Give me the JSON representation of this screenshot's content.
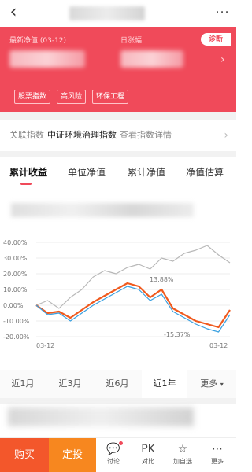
{
  "header": {
    "back_icon": "chevron-left-icon",
    "more_icon": "more-dots-icon"
  },
  "summary": {
    "nav_label": "最新净值 (03-12)",
    "rise_label": "日涨幅",
    "diagnose_label": "诊断",
    "tags": [
      "股票指数",
      "高风险",
      "环保工程"
    ]
  },
  "index": {
    "label": "关联指数",
    "name": "中证环境治理指数",
    "detail": "查看指数详情"
  },
  "tabs": [
    "累计收益",
    "单位净值",
    "累计净值",
    "净值估算"
  ],
  "chart_data": {
    "type": "line",
    "y_ticks": [
      "40.00%",
      "30.00%",
      "20.00%",
      "10.00%",
      "0.00%",
      "-10.00%",
      "-20.00%"
    ],
    "ylim": [
      -20,
      40
    ],
    "x_ticks": [
      "03-12",
      "03-12"
    ],
    "annotations": [
      "13.88%",
      "-15.37%"
    ],
    "series": [
      {
        "color": "#b8b8b8",
        "values": [
          0,
          3,
          -2,
          5,
          10,
          18,
          22,
          20,
          24,
          26,
          23,
          30,
          28,
          33,
          35,
          38,
          32,
          27
        ]
      },
      {
        "color": "#f05a1e",
        "values": [
          0,
          -5,
          -4,
          -8,
          -3,
          2,
          6,
          10,
          14,
          12,
          5,
          10,
          -2,
          -6,
          -10,
          -12,
          -14,
          -3
        ]
      },
      {
        "color": "#3aa0e0",
        "values": [
          0,
          -6,
          -5,
          -10,
          -5,
          0,
          4,
          8,
          12,
          10,
          3,
          7,
          -4,
          -8,
          -12,
          -15,
          -17,
          -6
        ]
      }
    ]
  },
  "ranges": [
    "近1月",
    "近3月",
    "近6月",
    "近1年",
    "更多"
  ],
  "bottom": {
    "buy_label": "购买",
    "plan_label": "定投",
    "actions": [
      {
        "label": "讨论",
        "icon": "chat-icon",
        "glyph": "💬"
      },
      {
        "label": "对比",
        "icon": "pk-icon",
        "glyph": "PK"
      },
      {
        "label": "加自选",
        "icon": "star-icon",
        "glyph": "☆"
      },
      {
        "label": "更多",
        "icon": "more-icon",
        "glyph": "⋯"
      }
    ]
  }
}
